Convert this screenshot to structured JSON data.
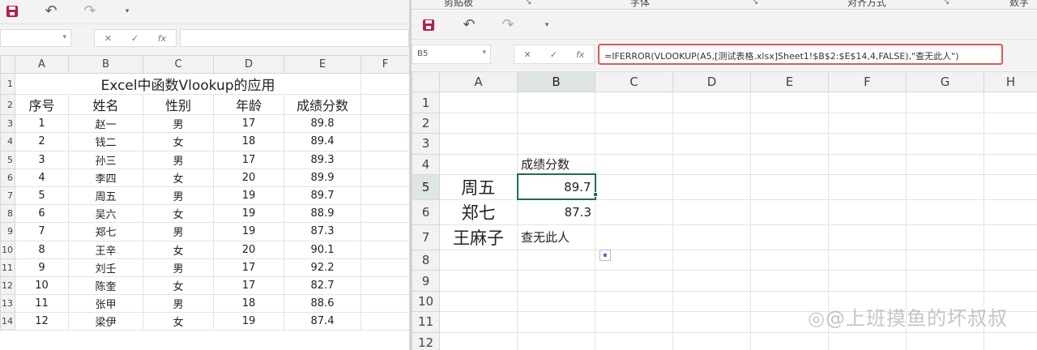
{
  "left": {
    "name_box": "",
    "name_box_dropdown": "▾",
    "fx_cancel": "✕",
    "fx_enter": "✓",
    "fx_insert": "fx",
    "formula": "",
    "columns": [
      "A",
      "B",
      "C",
      "D",
      "E",
      "F"
    ],
    "rows": [
      "1",
      "2",
      "3",
      "4",
      "5",
      "6",
      "7",
      "8",
      "9",
      "10",
      "11",
      "12",
      "13",
      "14"
    ],
    "title": "Excel中函数Vlookup的应用",
    "headers": [
      "序号",
      "姓名",
      "性别",
      "年龄",
      "成绩分数"
    ],
    "data": [
      [
        "1",
        "赵一",
        "男",
        "17",
        "89.8"
      ],
      [
        "2",
        "钱二",
        "女",
        "18",
        "89.4"
      ],
      [
        "3",
        "孙三",
        "男",
        "17",
        "89.3"
      ],
      [
        "4",
        "李四",
        "女",
        "20",
        "89.9"
      ],
      [
        "5",
        "周五",
        "男",
        "19",
        "89.7"
      ],
      [
        "6",
        "吴六",
        "女",
        "19",
        "88.9"
      ],
      [
        "7",
        "郑七",
        "男",
        "19",
        "87.3"
      ],
      [
        "8",
        "王辛",
        "女",
        "20",
        "90.1"
      ],
      [
        "9",
        "刘壬",
        "男",
        "17",
        "92.2"
      ],
      [
        "10",
        "陈奎",
        "女",
        "17",
        "82.7"
      ],
      [
        "11",
        "张甲",
        "男",
        "18",
        "88.6"
      ],
      [
        "12",
        "梁伊",
        "女",
        "19",
        "87.4"
      ]
    ]
  },
  "right": {
    "ribbon_groups": [
      "剪贴板",
      "字体",
      "对齐方式",
      "数字"
    ],
    "ribbon_launcher": "↘",
    "name_box": "B5",
    "name_box_dropdown": "▾",
    "fx_cancel": "✕",
    "fx_enter": "✓",
    "fx_insert": "fx",
    "formula": "=IFERROR(VLOOKUP(A5,[测试表格.xlsx]Sheet1!$B$2:$E$14,4,FALSE),\"查无此人\")",
    "columns": [
      "A",
      "B",
      "C",
      "D",
      "E",
      "F",
      "G",
      "H"
    ],
    "rows": [
      "1",
      "2",
      "3",
      "4",
      "5",
      "6",
      "7",
      "8",
      "9",
      "10",
      "11",
      "12"
    ],
    "header_b4": "成绩分数",
    "lookups": [
      {
        "name": "周五",
        "result": "89.7"
      },
      {
        "name": "郑七",
        "result": "87.3"
      },
      {
        "name": "王麻子",
        "result": "查无此人"
      }
    ],
    "watermark": "◎@上班摸鱼的坏叔叔"
  },
  "qat": {
    "undo": "↶",
    "redo": "↷",
    "customize": "▾"
  },
  "colors": {
    "accent_green": "#1e7145",
    "highlight_red": "#e05a4f",
    "save_icon": "#b32145"
  }
}
